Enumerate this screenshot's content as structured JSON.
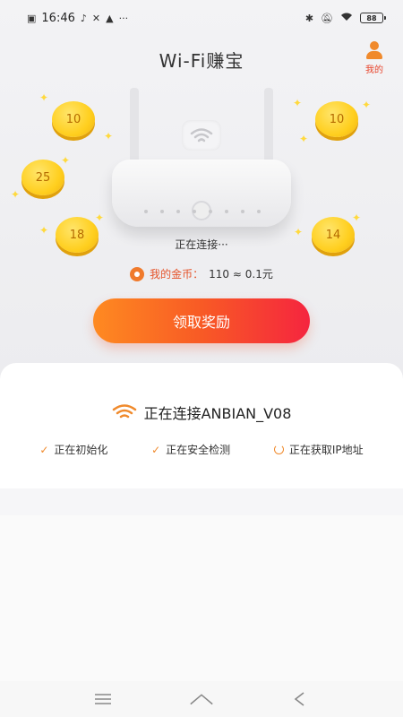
{
  "status_bar": {
    "time": "16:46",
    "left_icons": [
      "message-icon",
      "tiktok-icon",
      "tools-icon",
      "warning-icon",
      "more-icon"
    ],
    "battery": "88"
  },
  "header": {
    "title": "Wi-Fi赚宝",
    "profile_label": "我的"
  },
  "coins": [
    {
      "value": "10"
    },
    {
      "value": "10"
    },
    {
      "value": "25"
    },
    {
      "value": "18"
    },
    {
      "value": "14"
    }
  ],
  "connecting_text": "正在连接···",
  "balance": {
    "label": "我的金币：",
    "value": "110 ≈ 0.1元"
  },
  "claim_button": "领取奖励",
  "connection": {
    "title": "正在连接ANBIAN_V08",
    "steps": [
      {
        "label": "正在初始化",
        "state": "done"
      },
      {
        "label": "正在安全检测",
        "state": "done"
      },
      {
        "label": "正在获取IP地址",
        "state": "loading"
      }
    ]
  },
  "colors": {
    "accent": "#f08a2c",
    "button_start": "#fe8a21",
    "button_end": "#f5253f",
    "coin": "#ffcf1f"
  }
}
